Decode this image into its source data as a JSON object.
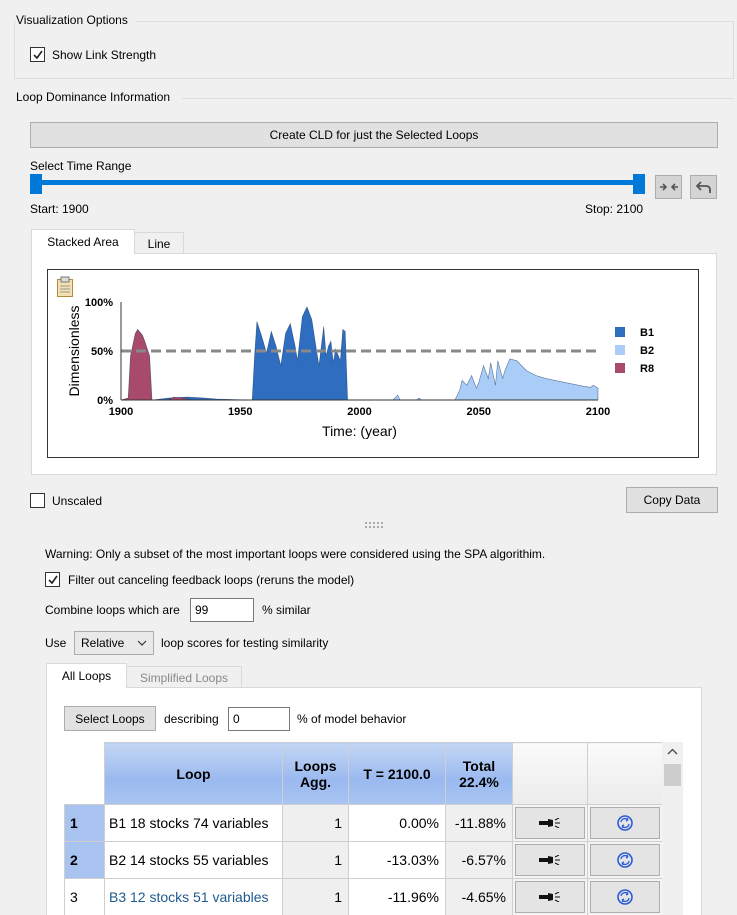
{
  "visualization": {
    "title": "Visualization Options",
    "show_link_strength": {
      "label": "Show Link Strength",
      "checked": true
    }
  },
  "loop_dominance": {
    "title": "Loop Dominance Information",
    "create_cld_button": "Create CLD for just the Selected Loops",
    "time_range_label": "Select Time Range",
    "start_label": "Start: 1900",
    "stop_label": "Stop: 2100",
    "slider": {
      "min": 1900,
      "max": 2100,
      "start": 1900,
      "stop": 2100
    },
    "tabs": [
      "Stacked Area",
      "Line"
    ],
    "active_tab": 0,
    "unscaled": {
      "label": "Unscaled",
      "checked": false
    },
    "copy_data_button": "Copy Data"
  },
  "chart_data": {
    "type": "area",
    "xlabel": "Time: (year)",
    "ylabel": "Dimensionless",
    "xlim": [
      1900,
      2100
    ],
    "ylim": [
      0,
      100
    ],
    "x_ticks": [
      "1900",
      "1950",
      "2000",
      "2050",
      "2100"
    ],
    "y_ticks": [
      "0%",
      "50%",
      "100%"
    ],
    "reference_line": 50,
    "legend_position": "right",
    "series": [
      {
        "name": "B1",
        "color": "#2e6dbf",
        "points": [
          [
            1913,
            0
          ],
          [
            1920,
            2
          ],
          [
            1928,
            3
          ],
          [
            1935,
            2
          ],
          [
            1940,
            1
          ],
          [
            1955,
            0
          ],
          [
            1956,
            45
          ],
          [
            1957,
            80
          ],
          [
            1959,
            65
          ],
          [
            1961,
            48
          ],
          [
            1963,
            70
          ],
          [
            1965,
            55
          ],
          [
            1967,
            35
          ],
          [
            1969,
            68
          ],
          [
            1971,
            78
          ],
          [
            1973,
            55
          ],
          [
            1974,
            40
          ],
          [
            1976,
            85
          ],
          [
            1978,
            95
          ],
          [
            1980,
            82
          ],
          [
            1982,
            50
          ],
          [
            1983,
            35
          ],
          [
            1985,
            75
          ],
          [
            1986,
            45
          ],
          [
            1987,
            55
          ],
          [
            1988,
            60
          ],
          [
            1989,
            38
          ],
          [
            1990,
            52
          ],
          [
            1992,
            40
          ],
          [
            1993,
            72
          ],
          [
            1994,
            70
          ],
          [
            1995,
            0
          ]
        ]
      },
      {
        "name": "B2",
        "color": "#a9cdf7",
        "points": [
          [
            2014,
            0
          ],
          [
            2016,
            5
          ],
          [
            2017,
            0
          ],
          [
            2024,
            0
          ],
          [
            2025,
            2
          ],
          [
            2026,
            0
          ],
          [
            2040,
            0
          ],
          [
            2042,
            10
          ],
          [
            2043,
            20
          ],
          [
            2045,
            15
          ],
          [
            2047,
            25
          ],
          [
            2049,
            12
          ],
          [
            2050,
            18
          ],
          [
            2052,
            35
          ],
          [
            2054,
            22
          ],
          [
            2055,
            38
          ],
          [
            2057,
            15
          ],
          [
            2058,
            40
          ],
          [
            2060,
            22
          ],
          [
            2061,
            30
          ],
          [
            2063,
            42
          ],
          [
            2066,
            40
          ],
          [
            2070,
            30
          ],
          [
            2074,
            25
          ],
          [
            2078,
            22
          ],
          [
            2082,
            20
          ],
          [
            2086,
            18
          ],
          [
            2090,
            16
          ],
          [
            2094,
            14
          ],
          [
            2097,
            13
          ],
          [
            2098,
            15
          ],
          [
            2100,
            12
          ],
          [
            2100,
            0
          ]
        ]
      },
      {
        "name": "R8",
        "color": "#a84a6b",
        "points": [
          [
            1900,
            0
          ],
          [
            1903,
            2
          ],
          [
            1904,
            45
          ],
          [
            1906,
            68
          ],
          [
            1907,
            72
          ],
          [
            1909,
            66
          ],
          [
            1910,
            60
          ],
          [
            1912,
            45
          ],
          [
            1913,
            0
          ],
          [
            1920,
            0
          ],
          [
            1922,
            3
          ],
          [
            1926,
            2
          ],
          [
            1930,
            0
          ]
        ]
      }
    ]
  },
  "options": {
    "warning": "Warning: Only a subset of the most important loops were considered using the SPA algorithim.",
    "filter": {
      "label": "Filter out canceling feedback loops (reruns the model)",
      "checked": true
    },
    "combine_prefix": "Combine loops which are",
    "combine_value": "99",
    "combine_suffix": "% similar",
    "use_prefix": "Use",
    "use_value": "Relative",
    "use_suffix": "loop scores for testing similarity"
  },
  "loops_tabs": [
    "All Loops",
    "Simplified Loops"
  ],
  "active_loops_tab": 0,
  "select_loops": {
    "button": "Select Loops",
    "describing": "describing",
    "value": "0",
    "suffix": "% of model behavior"
  },
  "table": {
    "headers": {
      "loop": "Loop",
      "agg": "Loops Agg.",
      "t": "T = 2100.0",
      "total": "Total 22.4%"
    },
    "rows": [
      {
        "num": "1",
        "name": "B1 18 stocks 74 variables",
        "agg": "1",
        "t": "0.00%",
        "total": "-11.88%",
        "selected": true,
        "link": false
      },
      {
        "num": "2",
        "name": "B2 14 stocks 55 variables",
        "agg": "1",
        "t": "-13.03%",
        "total": "-6.57%",
        "selected": true,
        "link": false
      },
      {
        "num": "3",
        "name": "B3 12 stocks 51 variables",
        "agg": "1",
        "t": "-11.96%",
        "total": "-4.65%",
        "selected": false,
        "link": true
      }
    ]
  },
  "colors": {
    "accent": "#0078d7",
    "link": "#1f5a8f"
  }
}
